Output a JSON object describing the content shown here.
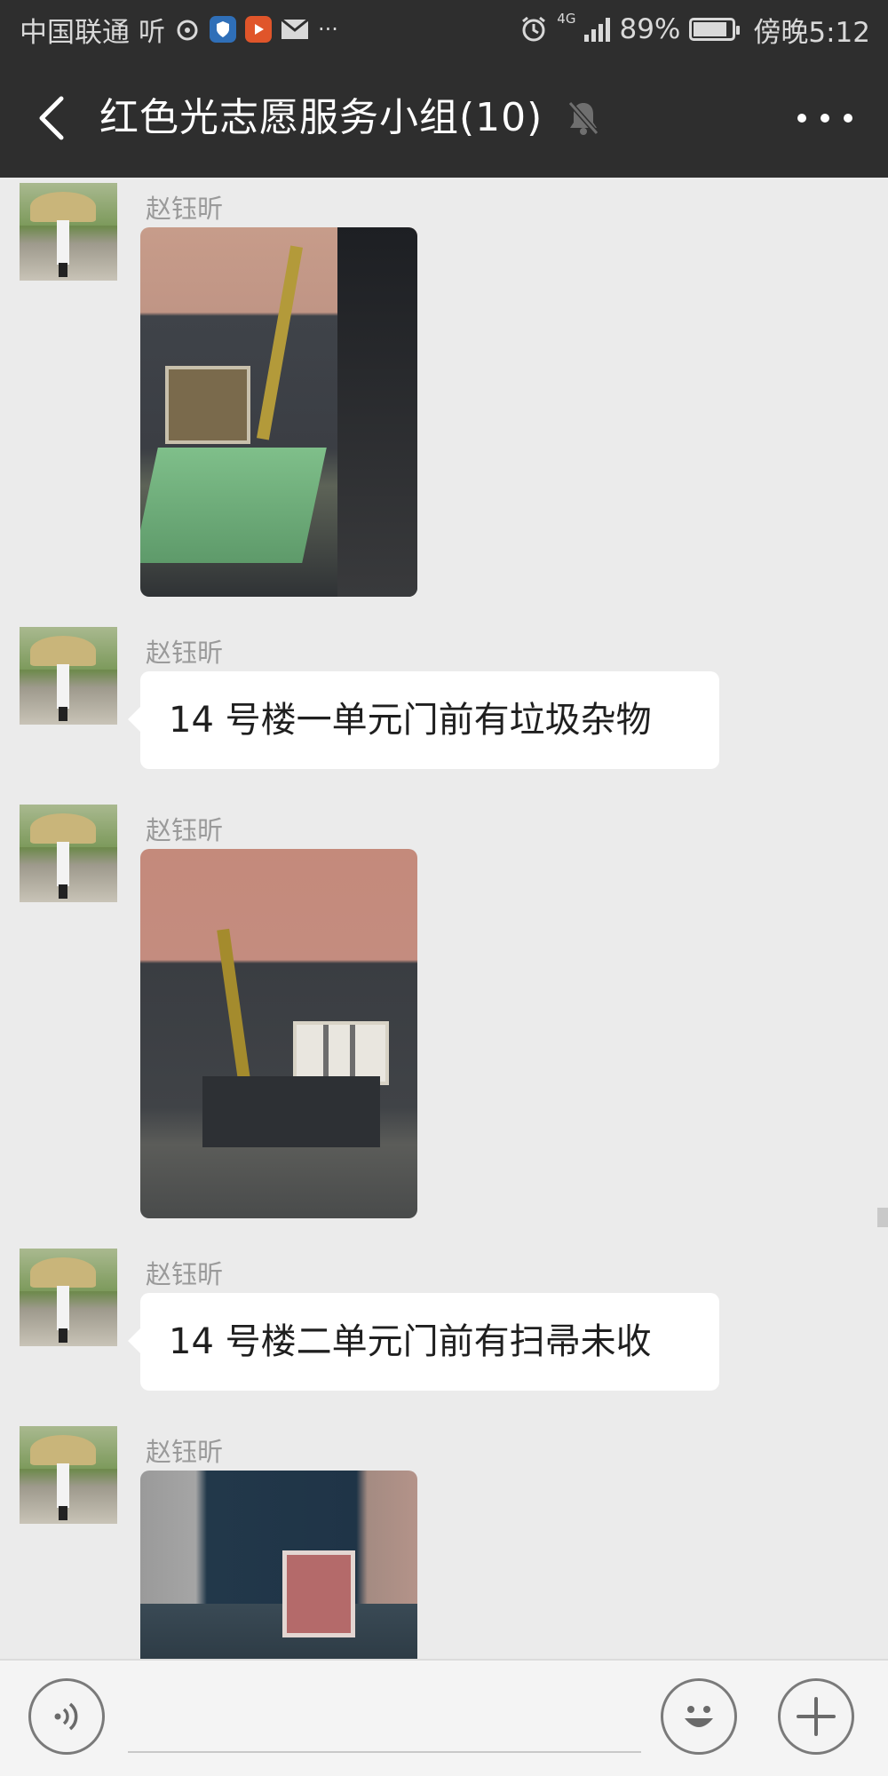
{
  "status_bar": {
    "carrier": "中国联通",
    "battery": "89%",
    "battery_level": 0.89,
    "network": "4G",
    "time": "傍晚5:12",
    "more_label": "···"
  },
  "header": {
    "title": "红色光志愿服务小组(10)",
    "muted": true
  },
  "messages": [
    {
      "sender": "赵钰昕",
      "type": "image"
    },
    {
      "sender": "赵钰昕",
      "type": "text",
      "text": "14 号楼一单元门前有垃圾杂物"
    },
    {
      "sender": "赵钰昕",
      "type": "image"
    },
    {
      "sender": "赵钰昕",
      "type": "text",
      "text": "14 号楼二单元门前有扫帚未收"
    },
    {
      "sender": "赵钰昕",
      "type": "image"
    }
  ],
  "icons": {
    "back": "back-arrow-icon",
    "mute": "bell-off-icon",
    "more": "more-icon",
    "voice": "voice-icon",
    "emoji": "emoji-icon",
    "plus": "plus-icon"
  },
  "colors": {
    "header_bg": "#2e2e2e",
    "chat_bg": "#ebebeb",
    "bubble": "#ffffff",
    "sender_name": "#9a9a9a"
  }
}
